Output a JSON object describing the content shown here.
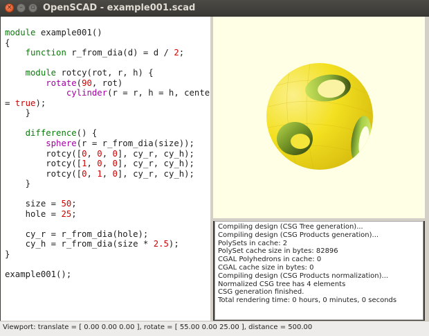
{
  "window": {
    "title": "OpenSCAD - example001.scad",
    "buttons": [
      "close-icon",
      "minimize-icon",
      "maximize-icon"
    ]
  },
  "editor": {
    "lines": [
      [
        {
          "t": "module",
          "c": "kw"
        },
        {
          "t": " example001()",
          "c": "pl"
        }
      ],
      [
        {
          "t": "{",
          "c": "pl"
        }
      ],
      [
        {
          "t": "    ",
          "c": "pl"
        },
        {
          "t": "function",
          "c": "kw"
        },
        {
          "t": " r_from_dia(d) = d / ",
          "c": "pl"
        },
        {
          "t": "2",
          "c": "num"
        },
        {
          "t": ";",
          "c": "pl"
        }
      ],
      [],
      [
        {
          "t": "    ",
          "c": "pl"
        },
        {
          "t": "module",
          "c": "kw"
        },
        {
          "t": " rotcy(rot, r, h) {",
          "c": "pl"
        }
      ],
      [
        {
          "t": "        ",
          "c": "pl"
        },
        {
          "t": "rotate",
          "c": "fn"
        },
        {
          "t": "(",
          "c": "pl"
        },
        {
          "t": "90",
          "c": "num"
        },
        {
          "t": ", rot)",
          "c": "pl"
        }
      ],
      [
        {
          "t": "            ",
          "c": "pl"
        },
        {
          "t": "cylinder",
          "c": "fn"
        },
        {
          "t": "(r = r, h = h, center",
          "c": "pl"
        }
      ],
      [
        {
          "t": "= ",
          "c": "pl"
        },
        {
          "t": "true",
          "c": "num"
        },
        {
          "t": ");",
          "c": "pl"
        }
      ],
      [
        {
          "t": "    }",
          "c": "pl"
        }
      ],
      [],
      [
        {
          "t": "    ",
          "c": "pl"
        },
        {
          "t": "difference",
          "c": "kw"
        },
        {
          "t": "() {",
          "c": "pl"
        }
      ],
      [
        {
          "t": "        ",
          "c": "pl"
        },
        {
          "t": "sphere",
          "c": "fn"
        },
        {
          "t": "(r = r_from_dia(size));",
          "c": "pl"
        }
      ],
      [
        {
          "t": "        rotcy([",
          "c": "pl"
        },
        {
          "t": "0",
          "c": "num"
        },
        {
          "t": ", ",
          "c": "pl"
        },
        {
          "t": "0",
          "c": "num"
        },
        {
          "t": ", ",
          "c": "pl"
        },
        {
          "t": "0",
          "c": "num"
        },
        {
          "t": "], cy_r, cy_h);",
          "c": "pl"
        }
      ],
      [
        {
          "t": "        rotcy([",
          "c": "pl"
        },
        {
          "t": "1",
          "c": "num"
        },
        {
          "t": ", ",
          "c": "pl"
        },
        {
          "t": "0",
          "c": "num"
        },
        {
          "t": ", ",
          "c": "pl"
        },
        {
          "t": "0",
          "c": "num"
        },
        {
          "t": "], cy_r, cy_h);",
          "c": "pl"
        }
      ],
      [
        {
          "t": "        rotcy([",
          "c": "pl"
        },
        {
          "t": "0",
          "c": "num"
        },
        {
          "t": ", ",
          "c": "pl"
        },
        {
          "t": "1",
          "c": "num"
        },
        {
          "t": ", ",
          "c": "pl"
        },
        {
          "t": "0",
          "c": "num"
        },
        {
          "t": "], cy_r, cy_h);",
          "c": "pl"
        }
      ],
      [
        {
          "t": "    }",
          "c": "pl"
        }
      ],
      [],
      [
        {
          "t": "    size = ",
          "c": "pl"
        },
        {
          "t": "50",
          "c": "num"
        },
        {
          "t": ";",
          "c": "pl"
        }
      ],
      [
        {
          "t": "    hole = ",
          "c": "pl"
        },
        {
          "t": "25",
          "c": "num"
        },
        {
          "t": ";",
          "c": "pl"
        }
      ],
      [],
      [
        {
          "t": "    cy_r = r_from_dia(hole);",
          "c": "pl"
        }
      ],
      [
        {
          "t": "    cy_h = r_from_dia(size * ",
          "c": "pl"
        },
        {
          "t": "2.5",
          "c": "num"
        },
        {
          "t": ");",
          "c": "pl"
        }
      ],
      [
        {
          "t": "}",
          "c": "pl"
        }
      ],
      [],
      [
        {
          "t": "example001();",
          "c": "pl"
        }
      ]
    ]
  },
  "viewport": {
    "background": "#ffffe5",
    "model": "example001 sphere with three cylindrical holes",
    "colors": {
      "face": "#f5e21e",
      "hole_light": "#a6cf4a",
      "hole_dark": "#50661a"
    }
  },
  "console": {
    "lines": [
      "Compiling design (CSG Tree generation)...",
      "Compiling design (CSG Products generation)...",
      "PolySets in cache: 2",
      "PolySet cache size in bytes: 82896",
      "CGAL Polyhedrons in cache: 0",
      "CGAL cache size in bytes: 0",
      "Compiling design (CSG Products normalization)...",
      "Normalized CSG tree has 4 elements",
      "CSG generation finished.",
      "Total rendering time: 0 hours, 0 minutes, 0 seconds"
    ]
  },
  "statusbar": {
    "text": "Viewport: translate = [ 0.00 0.00 0.00 ], rotate = [ 55.00 0.00 25.00 ], distance = 500.00"
  }
}
